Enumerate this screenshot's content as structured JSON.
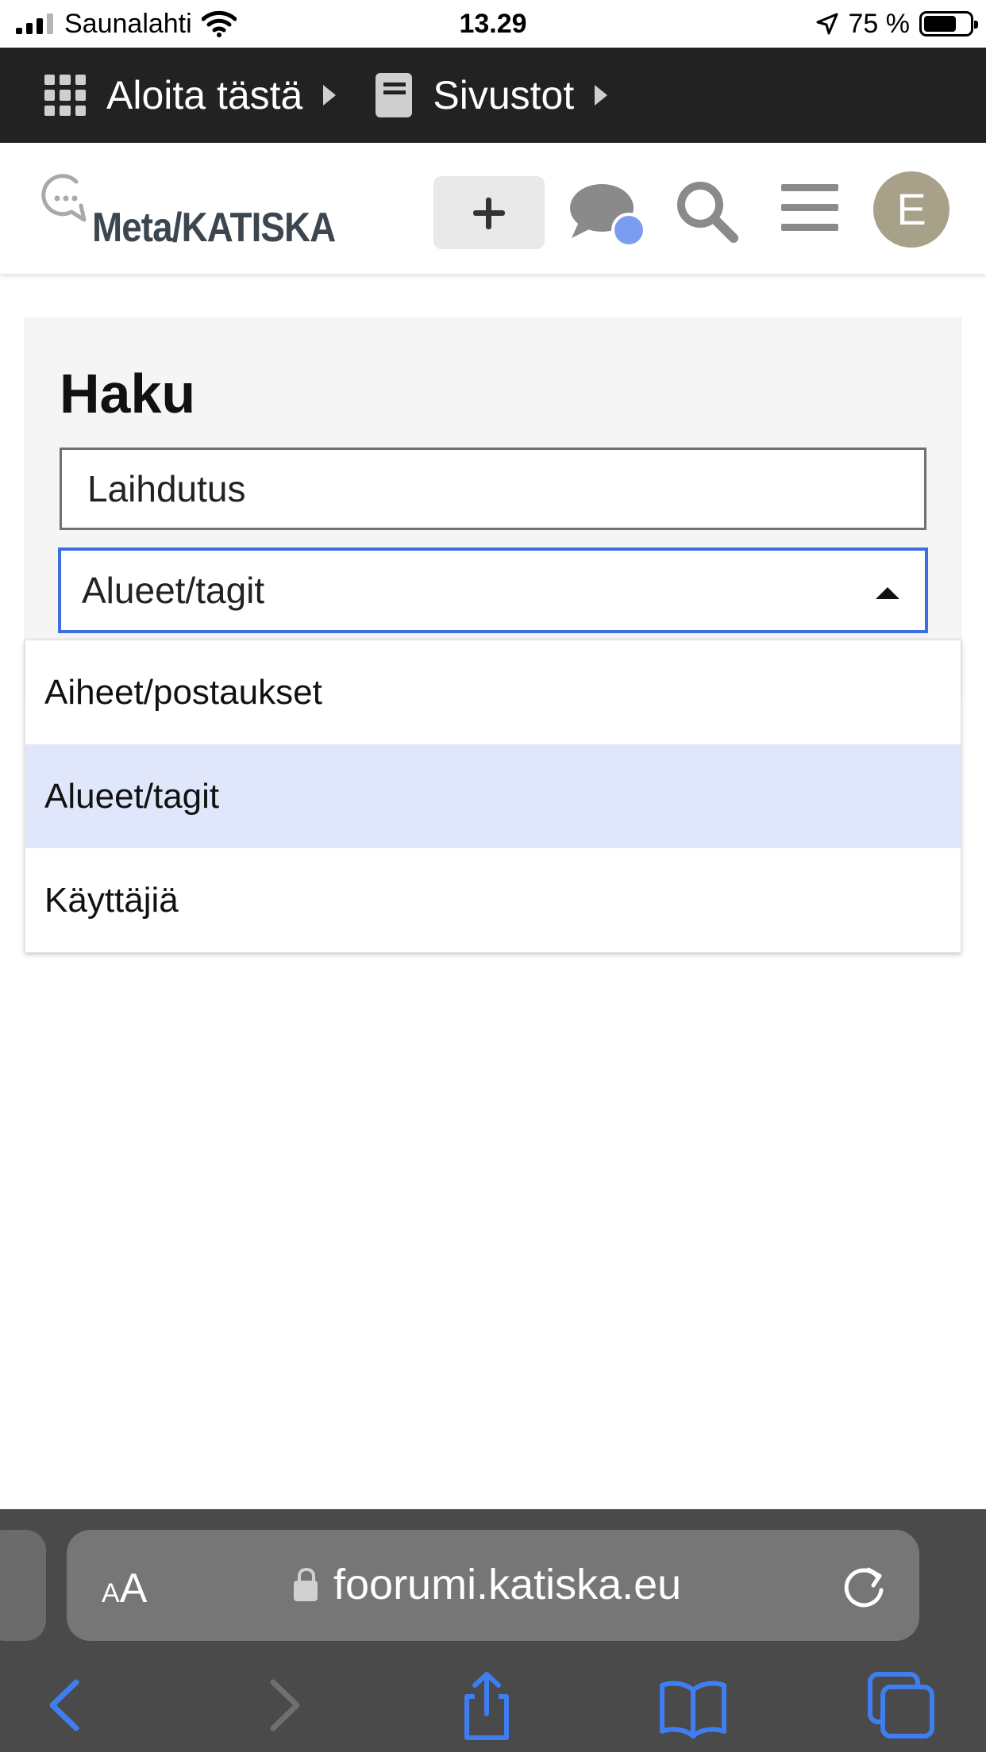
{
  "status_bar": {
    "carrier": "Saunalahti",
    "time": "13.29",
    "battery": "75 %"
  },
  "breadcrumb": {
    "items": [
      {
        "label": "Aloita tästä",
        "icon": "grid-icon"
      },
      {
        "label": "Sivustot",
        "icon": "book-icon"
      }
    ]
  },
  "header": {
    "logo_text": "Meta/KATISKA",
    "avatar_letter": "E",
    "colors": {
      "avatar_bg": "#a8a18a",
      "notification_dot": "#7c9cf0"
    }
  },
  "search": {
    "title": "Haku",
    "query_value": "Laihdutus",
    "selected_type": "Alueet/tagit",
    "options": [
      {
        "label": "Aiheet/postaukset",
        "selected": false
      },
      {
        "label": "Alueet/tagit",
        "selected": true
      },
      {
        "label": "Käyttäjiä",
        "selected": false
      }
    ],
    "focus_color": "#3d6fe0"
  },
  "browser": {
    "text_size_label_small": "A",
    "text_size_label_large": "A",
    "url": "foorumi.katiska.eu"
  }
}
